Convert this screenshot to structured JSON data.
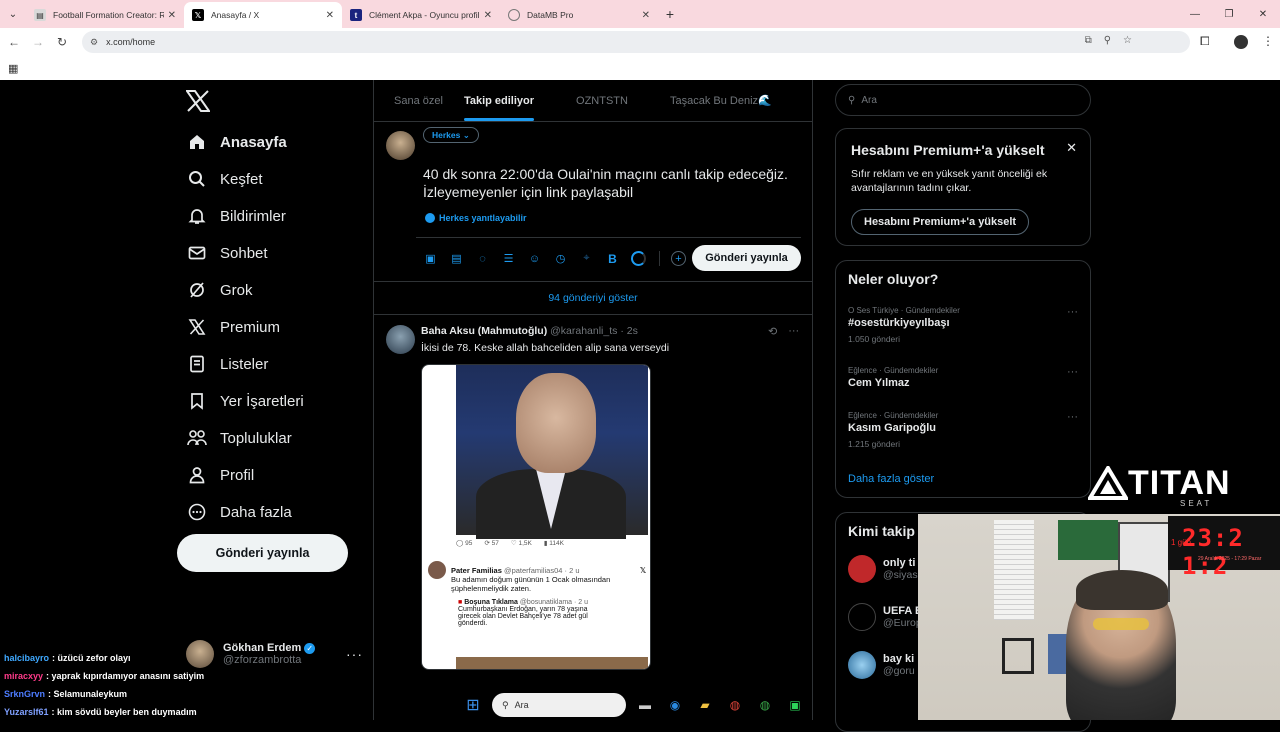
{
  "browser": {
    "tabs": [
      {
        "title": "Football Formation Creator: Re",
        "active": false
      },
      {
        "title": "Anasayfa / X",
        "active": true
      },
      {
        "title": "Clément Akpa - Oyuncu profili",
        "active": false
      },
      {
        "title": "DataMB Pro",
        "active": false
      }
    ],
    "url": "x.com/home"
  },
  "sidebar": {
    "items": [
      {
        "label": "Anasayfa",
        "icon": "home-icon"
      },
      {
        "label": "Keşfet",
        "icon": "search-icon"
      },
      {
        "label": "Bildirimler",
        "icon": "bell-icon"
      },
      {
        "label": "Sohbet",
        "icon": "mail-icon"
      },
      {
        "label": "Grok",
        "icon": "grok-icon"
      },
      {
        "label": "Premium",
        "icon": "x-icon"
      },
      {
        "label": "Listeler",
        "icon": "list-icon"
      },
      {
        "label": "Yer İşaretleri",
        "icon": "bookmark-icon"
      },
      {
        "label": "Topluluklar",
        "icon": "communities-icon"
      },
      {
        "label": "Profil",
        "icon": "user-icon"
      },
      {
        "label": "Daha fazla",
        "icon": "more-icon"
      }
    ],
    "post_button": "Gönderi yayınla",
    "profile": {
      "name": "Gökhan Erdem",
      "handle": "@zforzambrotta"
    }
  },
  "timeline": {
    "tabs": [
      "Sana özel",
      "Takip ediliyor",
      "OZNTSTN",
      "Taşacak Bu Deniz🌊"
    ],
    "compose": {
      "audience": "Herkes",
      "text": "40 dk sonra 22:00'da Oulai'nin maçını canlı takip edeceğiz. İzleyemeyenler için link paylaşabil",
      "reply_setting": "Herkes yanıtlayabilir",
      "post_button": "Gönderi yayınla"
    },
    "show_more": "94 gönderiyi göster",
    "tweet": {
      "name": "Baha Aksu (Mahmutoğlu)",
      "handle": "@karahanli_ts",
      "time": "2s",
      "text": "İkisi de 78. Keske allah bahceliden alip sana verseydi",
      "media": {
        "stats": [
          "95",
          "57",
          "1,5K",
          "114K"
        ],
        "quote_name": "Pater Familias",
        "quote_handle": "@paterfamilias04 · 2 u",
        "quote_text_1": "Bu adamın doğum gününün 1 Ocak olmasından",
        "quote_text_2": "şüphelenmeliydik zaten.",
        "inner_name": "Boşuna Tıklama",
        "inner_handle": "@bosunatiklama · 2 u",
        "inner_text_1": "Cumhurbaşkanı Erdoğan, yarın 78 yaşına",
        "inner_text_2": "girecek olan Devlet Bahçeli'ye 78 adet gül",
        "inner_text_3": "gönderdi."
      }
    }
  },
  "right": {
    "search_placeholder": "Ara",
    "premium": {
      "title": "Hesabını Premium+'a yükselt",
      "desc": "Sıfır reklam ve en yüksek yanıt önceliği ek avantajlarının tadını çıkar.",
      "button": "Hesabını Premium+'a yükselt"
    },
    "trends": {
      "title": "Neler oluyor?",
      "items": [
        {
          "context": "O Ses Türkiye · Gündemdekiler",
          "name": "#osestürkiyeyılbaşı",
          "count": "1.050 gönderi"
        },
        {
          "context": "Eğlence · Gündemdekiler",
          "name": "Cem Yılmaz",
          "count": ""
        },
        {
          "context": "Eğlence · Gündemdekiler",
          "name": "Kasım Garipoğlu",
          "count": "1.215 gönderi"
        }
      ],
      "show_more": "Daha fazla göster"
    },
    "who": {
      "title": "Kimi takip",
      "items": [
        {
          "name": "only ti",
          "handle": "@siyas"
        },
        {
          "name": "UEFA E",
          "handle": "@Europ"
        },
        {
          "name": "bay ki",
          "handle": "@goru"
        }
      ]
    }
  },
  "overlay": {
    "brand": "TITAN",
    "brand_sub": "SEAT",
    "clock": "23:2 1:2",
    "clock_day": "1 gün",
    "clock_date": "29 Aralık 2025 - 17:29 Pazar",
    "chat": [
      {
        "user": "halcibayro",
        "text": ": üzücü zefor olayı",
        "color": "#3fa9ff"
      },
      {
        "user": "miracxyy",
        "text": ": yaprak kıpırdamıyor anasını satiyim",
        "color": "#ff3b8a"
      },
      {
        "user": "SrknGrvn",
        "text": ": Selamunaleykum",
        "color": "#4d7cff"
      },
      {
        "user": "Yuzarslf61",
        "text": ": kim sövdü beyler ben duymadım",
        "color": "#7fa0ff"
      }
    ],
    "taskbar_search": "Ara"
  }
}
